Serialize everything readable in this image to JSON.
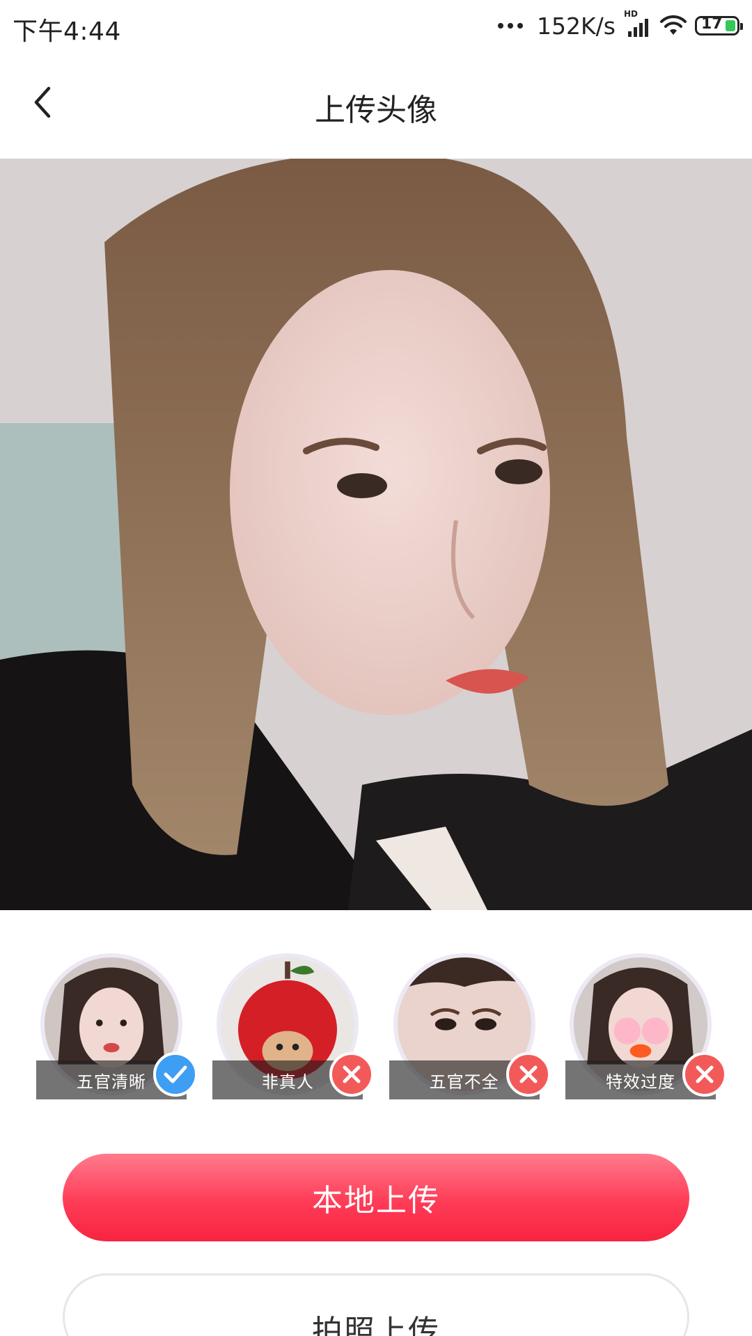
{
  "status_bar": {
    "time": "下午4:44",
    "net_speed": "152K/s",
    "network_badge": "HD",
    "battery_level": "17"
  },
  "header": {
    "title": "上传头像",
    "back_icon": "chevron-left-icon"
  },
  "examples": [
    {
      "caption": "五官清晰",
      "status": "ok",
      "icon": "check-icon",
      "color": "#3d9ef3"
    },
    {
      "caption": "非真人",
      "status": "bad",
      "icon": "close-icon",
      "color": "#f25a5a"
    },
    {
      "caption": "五官不全",
      "status": "bad",
      "icon": "close-icon",
      "color": "#f25a5a"
    },
    {
      "caption": "特效过度",
      "status": "bad",
      "icon": "close-icon",
      "color": "#f25a5a"
    }
  ],
  "buttons": {
    "local_upload": "本地上传",
    "camera_upload": "拍照上传"
  },
  "colors": {
    "primary": "#ff3c57",
    "ok_badge": "#3d9ef3",
    "bad_badge": "#f25a5a"
  }
}
